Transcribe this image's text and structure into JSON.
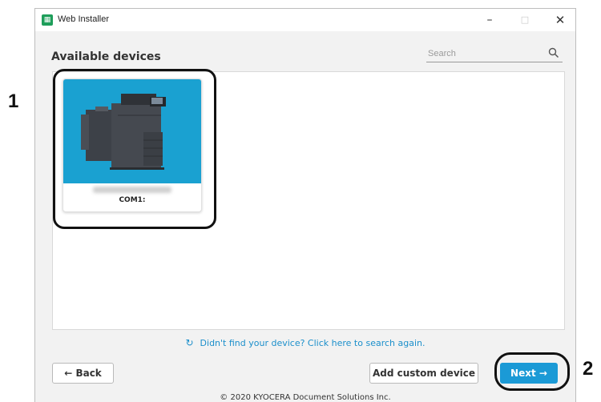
{
  "window": {
    "title": "Web Installer",
    "icon": "app-grid-icon"
  },
  "window_controls": {
    "minimize": "–",
    "maximize": "□",
    "close": "✕"
  },
  "main": {
    "heading": "Available devices",
    "search": {
      "placeholder": "Search",
      "icon": "search-icon"
    }
  },
  "devices": [
    {
      "name": "",
      "port": "COM1:",
      "image": "printer-image",
      "background": "#1aa1d1"
    }
  ],
  "refresh": {
    "icon": "refresh-icon",
    "text": "Didn't find your device? Click here to search again."
  },
  "buttons": {
    "back": "Back",
    "add_custom": "Add custom device",
    "next": "Next"
  },
  "footer": {
    "copyright": "© 2020 KYOCERA Document Solutions Inc."
  },
  "callouts": [
    "1",
    "2"
  ],
  "colors": {
    "accent": "#1b9ad6",
    "card_bg": "#1aa1d1",
    "link": "#1b8fcb"
  }
}
